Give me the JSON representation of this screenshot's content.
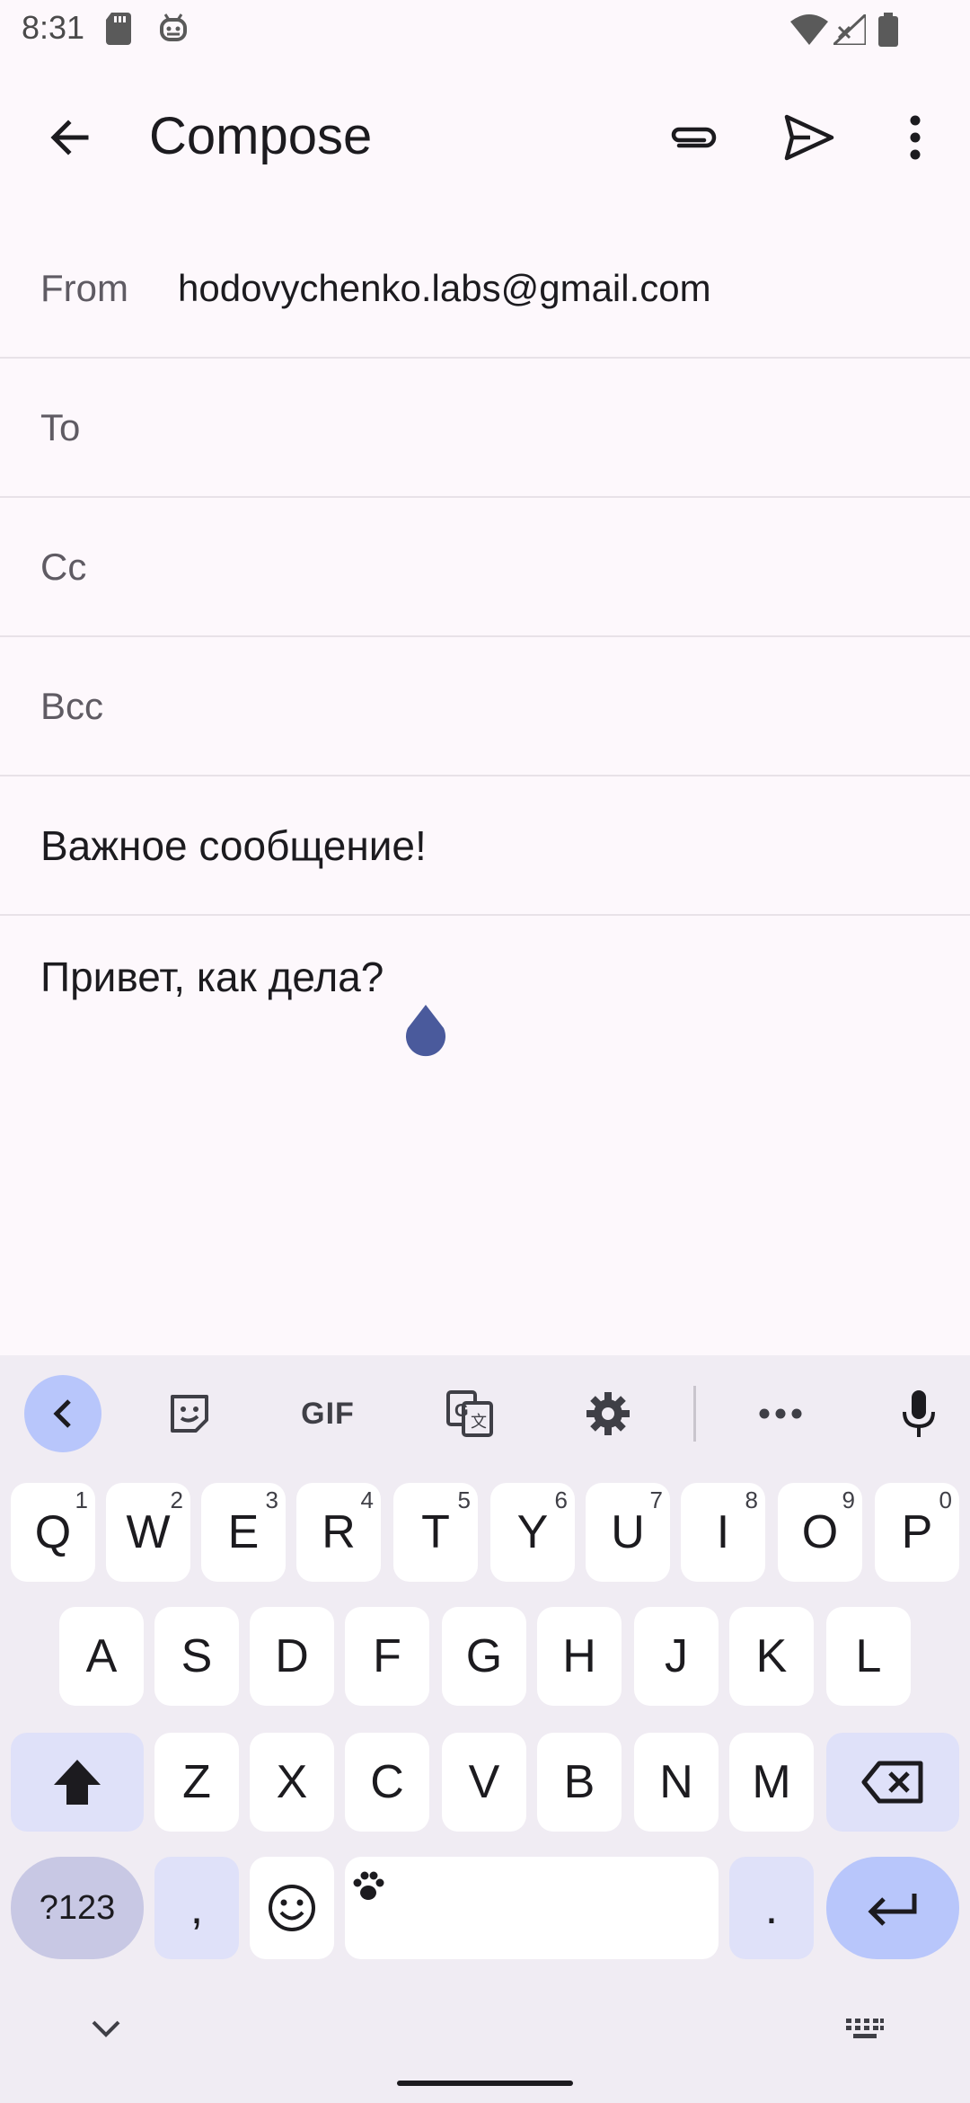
{
  "status_bar": {
    "time": "8:31",
    "icons": [
      "sd-card-icon",
      "android-debug-icon",
      "wifi-icon",
      "signal-icon",
      "battery-icon"
    ]
  },
  "toolbar": {
    "title": "Compose",
    "back_icon": "arrow-back-icon",
    "attach_icon": "paperclip-icon",
    "send_icon": "send-icon",
    "more_icon": "more-vert-icon"
  },
  "compose": {
    "from_label": "From",
    "from_value": "hodovychenko.labs@gmail.com",
    "to_label": "To",
    "cc_label": "Cc",
    "bcc_label": "Bcc",
    "subject": "Важное сообщение!",
    "body": "Привет, как дела?"
  },
  "keyboard": {
    "toolbar": {
      "gif_label": "GIF"
    },
    "row1": [
      {
        "key": "Q",
        "hint": "1"
      },
      {
        "key": "W",
        "hint": "2"
      },
      {
        "key": "E",
        "hint": "3"
      },
      {
        "key": "R",
        "hint": "4"
      },
      {
        "key": "T",
        "hint": "5"
      },
      {
        "key": "Y",
        "hint": "6"
      },
      {
        "key": "U",
        "hint": "7"
      },
      {
        "key": "I",
        "hint": "8"
      },
      {
        "key": "O",
        "hint": "9"
      },
      {
        "key": "P",
        "hint": "0"
      }
    ],
    "row2": [
      "A",
      "S",
      "D",
      "F",
      "G",
      "H",
      "J",
      "K",
      "L"
    ],
    "row3": [
      "Z",
      "X",
      "C",
      "V",
      "B",
      "N",
      "M"
    ],
    "row4": {
      "symbols_label": "?123",
      "comma": ",",
      "period": "."
    }
  },
  "colors": {
    "background": "#fdf8fc",
    "keyboard_bg": "#f0ecf3",
    "accent": "#b8c6fb",
    "cursor_handle": "#4a5a9c"
  }
}
